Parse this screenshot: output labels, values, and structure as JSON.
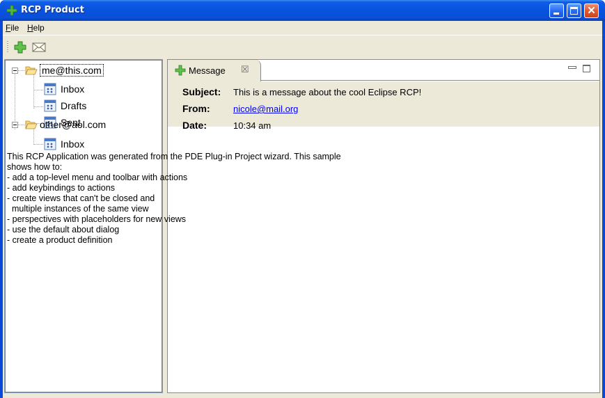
{
  "window": {
    "title": "RCP Product",
    "close_glyph": "✕"
  },
  "menubar": {
    "items": [
      {
        "label": "File"
      },
      {
        "label": "Help"
      }
    ]
  },
  "toolbar": {
    "tools": [
      {
        "icon": "add-icon"
      },
      {
        "icon": "mail-icon"
      }
    ]
  },
  "navigation": {
    "accounts": [
      {
        "label": "me@this.com",
        "folders": [
          "Inbox",
          "Drafts",
          "Sent"
        ]
      },
      {
        "label": "other@aol.com",
        "folders": [
          "Inbox"
        ]
      }
    ]
  },
  "message_view": {
    "tab_label": "Message",
    "tab_close": "☒",
    "subject_label": "Subject:",
    "subject_value": "This is a message about the cool Eclipse RCP!",
    "from_label": "From:",
    "from_value": "nicole@mail.org",
    "date_label": "Date:",
    "date_value": "10:34 am",
    "body": "This RCP Application was generated from the PDE Plug-in Project wizard. This sample\nshows how to:\n- add a top-level menu and toolbar with actions\n- add keybindings to actions\n- create views that can't be closed and\n  multiple instances of the same view\n- perspectives with placeholders for new views\n- use the default about dialog\n- create a product definition"
  },
  "colors": {
    "titlebar": "#0853df",
    "chrome": "#ece9d8",
    "link": "#0000ee",
    "close_button": "#e15a33"
  }
}
